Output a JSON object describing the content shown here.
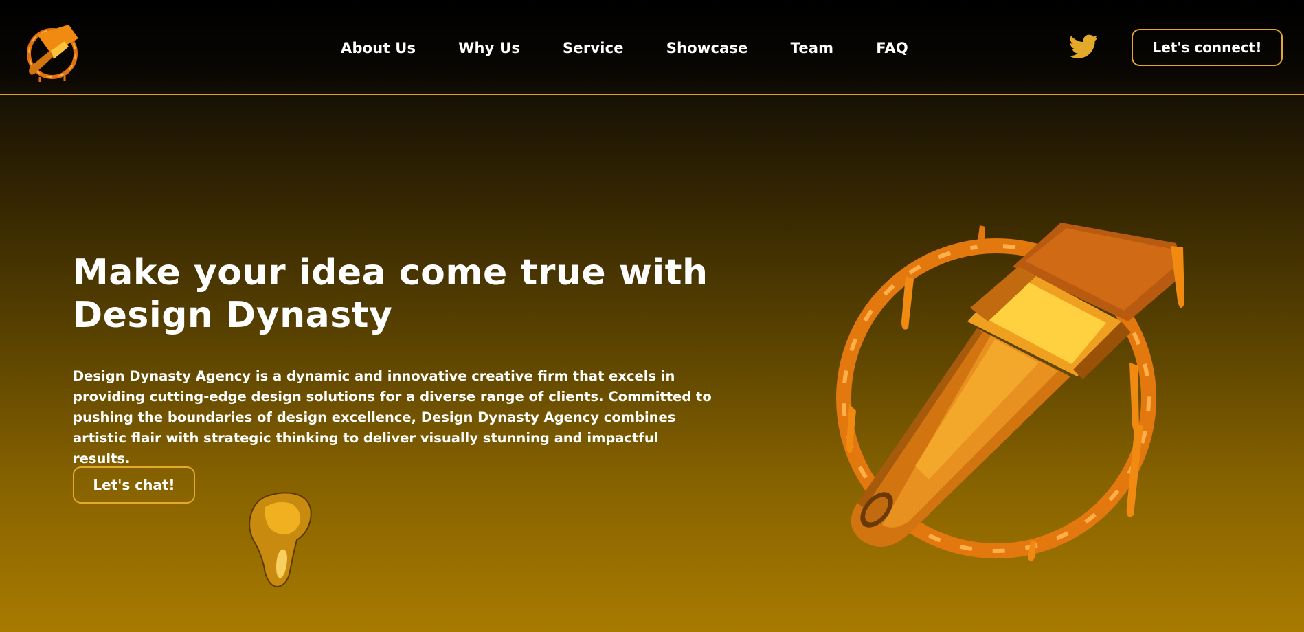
{
  "header": {
    "nav": [
      "About Us",
      "Why Us",
      "Service",
      "Showcase",
      "Team",
      "FAQ"
    ],
    "connect_label": "Let's connect!",
    "social_icon": "twitter-icon"
  },
  "hero": {
    "title": "Make your idea come true with Design Dynasty",
    "description": "Design Dynasty Agency is a dynamic and innovative creative firm that excels in providing cutting-edge design solutions for a diverse range of clients. Committed to pushing the boundaries of design excellence, Design Dynasty Agency combines artistic flair with strategic thinking to deliver visually stunning and impactful results.",
    "cta_label": "Let's chat!"
  },
  "colors": {
    "accent": "#e3a92a",
    "orange": "#f08a10",
    "background_top": "#000000",
    "background_bottom": "#a87a00"
  }
}
